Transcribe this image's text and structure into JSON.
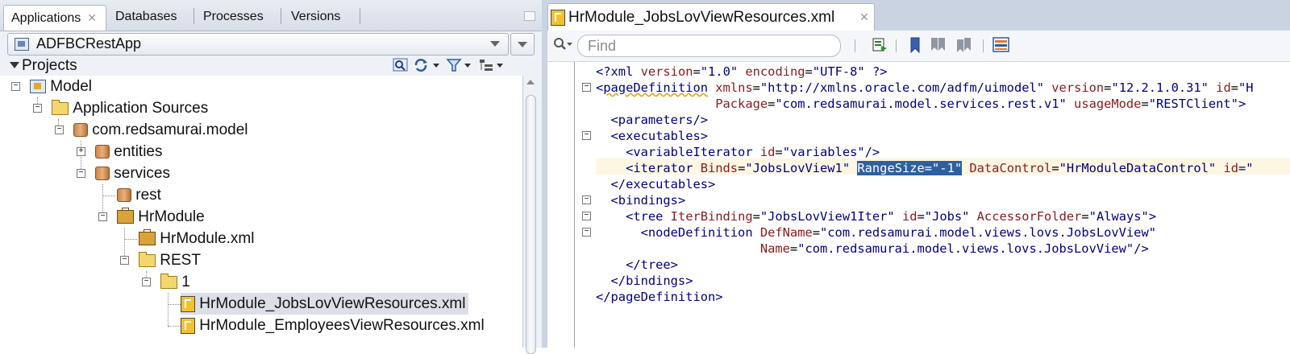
{
  "left_panel": {
    "tabs": [
      {
        "label": "Applications",
        "active": true
      },
      {
        "label": "Databases"
      },
      {
        "label": "Processes"
      },
      {
        "label": "Versions"
      }
    ],
    "app_selector": {
      "value": "ADFBCRestApp"
    },
    "projects_label": "Projects",
    "tree": [
      {
        "label": "Model",
        "icon": "project-icon"
      },
      {
        "label": "Application Sources",
        "icon": "folder-icon"
      },
      {
        "label": "com.redsamurai.model",
        "icon": "package-icon"
      },
      {
        "label": "entities",
        "icon": "package-icon"
      },
      {
        "label": "services",
        "icon": "package-icon"
      },
      {
        "label": "rest",
        "icon": "package-icon"
      },
      {
        "label": "HrModule",
        "icon": "application-module-icon"
      },
      {
        "label": "HrModule.xml",
        "icon": "application-module-icon"
      },
      {
        "label": "REST",
        "icon": "folder-icon"
      },
      {
        "label": "1",
        "icon": "folder-icon"
      },
      {
        "label": "HrModule_JobsLovViewResources.xml",
        "icon": "xml-file-icon",
        "selected": true
      },
      {
        "label": "HrModule_EmployeesViewResources.xml",
        "icon": "xml-file-icon"
      }
    ]
  },
  "editor": {
    "tab_title": "HrModule_JobsLovViewResources.xml",
    "find_placeholder": "Find",
    "code": {
      "l1": {
        "a": "<?xml ",
        "b": "version",
        "c": "=",
        "d": "\"1.0\"",
        "e": " encoding",
        "f": "=",
        "g": "\"UTF-8\"",
        "h": " ?>"
      },
      "l2": {
        "a": "<",
        "b": "pageDefinition",
        "c": " xmlns",
        "d": "=",
        "e": "\"http://xmlns.oracle.com/adfm/uimodel\"",
        "f": " version",
        "g": "=",
        "h": "\"12.2.1.0.31\"",
        "i": " id",
        "j": "=",
        "k": "\"H"
      },
      "l3": {
        "a": "                Package",
        "b": "=",
        "c": "\"com.redsamurai.model.services.rest.v1\"",
        "d": " usageMode",
        "e": "=",
        "f": "\"RESTClient\"",
        "g": ">"
      },
      "l4": {
        "a": "  <parameters/>"
      },
      "l5": {
        "a": "  <executables>"
      },
      "l6": {
        "a": "    <variableIterator ",
        "b": "id",
        "c": "=",
        "d": "\"variables\"",
        "e": "/>"
      },
      "l7": {
        "a": "    <iterator ",
        "b": "Binds",
        "c": "=",
        "d": "\"JobsLovView1\"",
        "e": " ",
        "f": "RangeSize=\"-1\"",
        "g": " DataControl",
        "h": "=",
        "i": "\"HrModuleDataControl\"",
        "j": " id",
        "k": "=\""
      },
      "l8": {
        "a": "  </executables>"
      },
      "l9": {
        "a": "  <bindings>"
      },
      "l10": {
        "a": "    <tree ",
        "b": "IterBinding",
        "c": "=",
        "d": "\"JobsLovView1Iter\"",
        "e": " id",
        "f": "=",
        "g": "\"Jobs\"",
        "h": " AccessorFolder",
        "i": "=",
        "j": "\"Always\"",
        "k": ">"
      },
      "l11": {
        "a": "      <nodeDefinition ",
        "b": "DefName",
        "c": "=",
        "d": "\"com.redsamurai.model.views.lovs.JobsLovView\""
      },
      "l12": {
        "a": "                      Name",
        "b": "=",
        "c": "\"com.redsamurai.model.views.lovs.JobsLovView\"",
        "d": "/>"
      },
      "l13": {
        "a": "    </tree>"
      },
      "l14": {
        "a": "  </bindings>"
      },
      "l15": {
        "a": "</pageDefinition>"
      }
    }
  }
}
